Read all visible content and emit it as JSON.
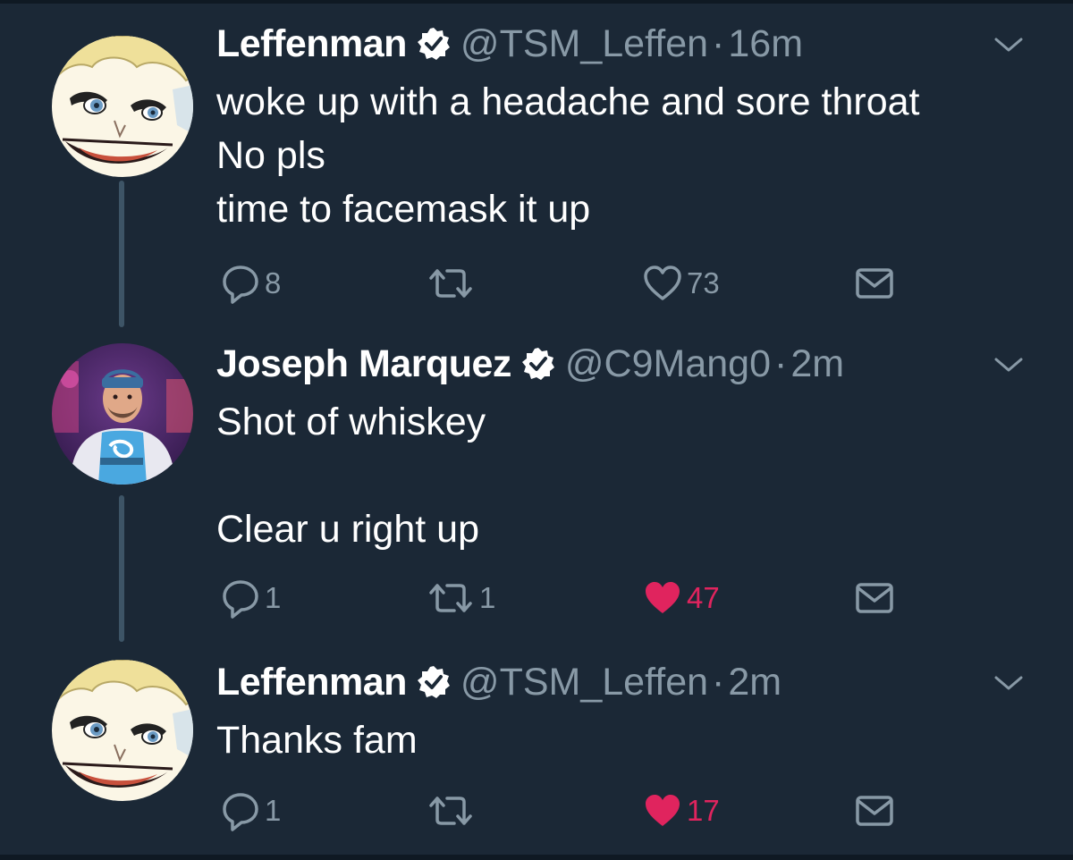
{
  "colors": {
    "background": "#1b2836",
    "text": "#ffffff",
    "secondary": "#8899a6",
    "like_active": "#e0245e",
    "thread_line": "#3d5466"
  },
  "tweets": [
    {
      "name": "Leffenman",
      "verified": true,
      "handle": "@TSM_Leffen",
      "separator": "·",
      "time": "16m",
      "lines": [
        "woke up with a headache and sore throat",
        "No pls",
        "time to facemask it up"
      ],
      "reply_count": "8",
      "retweet_count": "",
      "like_count": "73",
      "liked": false,
      "avatar_icon": "anime-character-avatar-icon"
    },
    {
      "name": "Joseph Marquez",
      "verified": true,
      "handle": "@C9Mang0",
      "separator": "·",
      "time": "2m",
      "lines": [
        "Shot of whiskey",
        "",
        "Clear u right up"
      ],
      "reply_count": "1",
      "retweet_count": "1",
      "like_count": "47",
      "liked": true,
      "avatar_icon": "person-photo-avatar-icon"
    },
    {
      "name": "Leffenman",
      "verified": true,
      "handle": "@TSM_Leffen",
      "separator": "·",
      "time": "2m",
      "lines": [
        "Thanks fam"
      ],
      "reply_count": "1",
      "retweet_count": "",
      "like_count": "17",
      "liked": true,
      "avatar_icon": "anime-character-avatar-icon"
    }
  ]
}
